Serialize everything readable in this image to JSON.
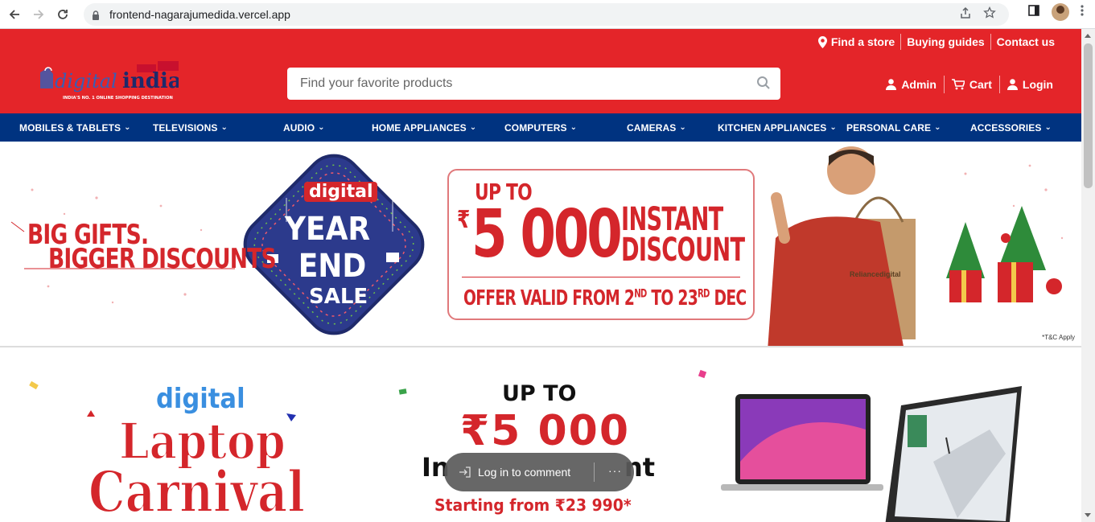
{
  "browser": {
    "url": "frontend-nagarajumedida.vercel.app"
  },
  "header": {
    "top_links": [
      {
        "label": "Find a store",
        "icon": "location-pin-icon"
      },
      {
        "label": "Buying guides"
      },
      {
        "label": "Contact us"
      }
    ],
    "logo": {
      "text_primary": "digital",
      "text_secondary": "india",
      "tagline": "INDIA'S NO. 1 ONLINE SHOPPING DESTINATION"
    },
    "search": {
      "placeholder": "Find your favorite products"
    },
    "account_links": [
      {
        "label": "Admin",
        "icon": "user-icon"
      },
      {
        "label": "Cart",
        "icon": "cart-icon"
      },
      {
        "label": "Login",
        "icon": "user-icon"
      }
    ]
  },
  "categories": [
    "MOBILES & TABLETS",
    "TELEVISIONS",
    "AUDIO",
    "HOME APPLIANCES",
    "COMPUTERS",
    "CAMERAS",
    "KITCHEN APPLIANCES",
    "PERSONAL CARE",
    "ACCESSORIES"
  ],
  "banner1": {
    "line1": "BIG GIFTS.",
    "line2": "BIGGER DISCOUNTS",
    "badge_brand": "digital",
    "badge_line1": "YEAR",
    "badge_line2": "END",
    "badge_line3": "SALE",
    "offer_upto": "UP TO",
    "offer_rupee": "₹",
    "offer_amount": "5 000",
    "offer_word1": "INSTANT",
    "offer_word2": "DISCOUNT",
    "offer_validity_a": "OFFER VALID FROM 2",
    "offer_validity_sup1": "ND",
    "offer_validity_b": " TO 23",
    "offer_validity_sup2": "RD",
    "offer_validity_c": " DEC",
    "bag_brand": "Reliancedigital",
    "tc": "*T&C Apply"
  },
  "banner2": {
    "brand": "digital",
    "title1": "Laptop",
    "title2": "Carnival",
    "upto": "UP TO",
    "amount": "₹5 000",
    "partial": "In",
    "partial2": "nt",
    "starting": "Starting from ₹23 990*"
  },
  "comment_pill": {
    "label": "Log in to comment",
    "more": "···"
  },
  "colors": {
    "header_red": "#e42529",
    "nav_blue": "#003380",
    "banner_red": "#d4262b"
  }
}
